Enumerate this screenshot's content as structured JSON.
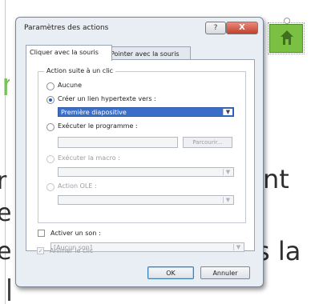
{
  "slide": {
    "line1_right": "nt",
    "line2": "e",
    "line3_right": "s la",
    "line1_left": "r",
    "line3_left": "e"
  },
  "dialog": {
    "title": "Paramètres des actions",
    "help_label": "?",
    "close_label": "X",
    "tabs": [
      {
        "label": "Cliquer avec la souris"
      },
      {
        "label": "Pointer avec la souris"
      }
    ],
    "action_group": {
      "legend": "Action suite à un clic",
      "none_label": "Aucune",
      "hyperlink_label": "Créer un lien hypertexte vers :",
      "hyperlink_value": "Première diapositive",
      "run_program_label": "Exécuter le programme :",
      "run_program_value": "",
      "browse_label": "Parcourir...",
      "run_macro_label": "Exécuter la macro :",
      "ole_action_label": "Action OLE :"
    },
    "sound": {
      "play_sound_label": "Activer un son :",
      "sound_value": "[Aucun son]",
      "highlight_label": "Animer le clic"
    },
    "ok_label": "OK",
    "cancel_label": "Annuler"
  },
  "colors": {
    "accent": "#3a6fc9",
    "shape_green": "#7ac143",
    "slide_green": "#79c25a"
  }
}
